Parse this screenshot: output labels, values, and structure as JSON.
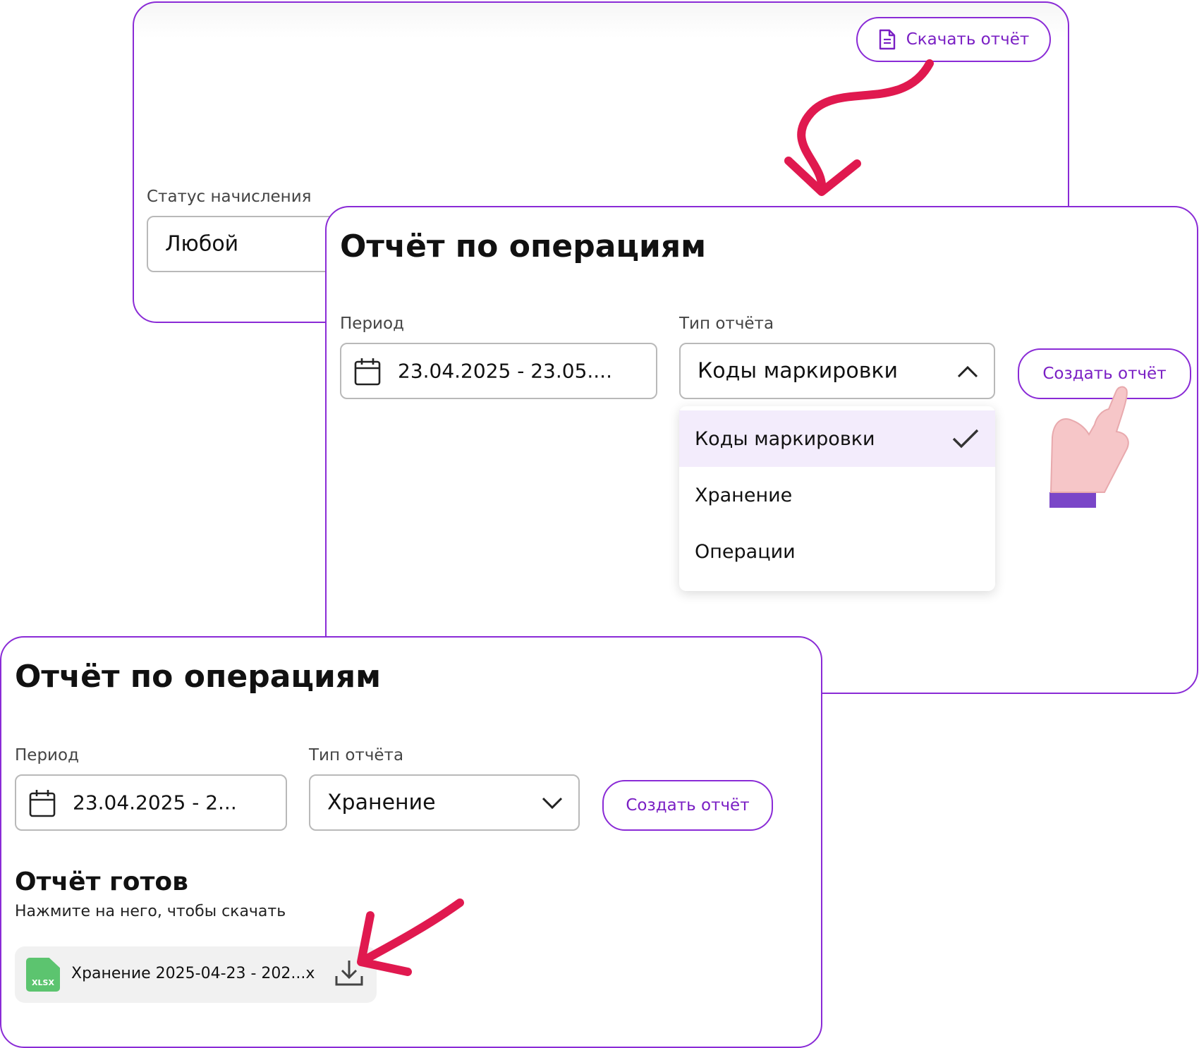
{
  "top_card": {
    "download_button_label": "Скачать отчёт",
    "status_label": "Статус начисления",
    "status_value": "Любой"
  },
  "middle_card": {
    "title": "Отчёт по операциям",
    "period_label": "Период",
    "period_value": "23.04.2025 - 23.05....",
    "type_label": "Тип отчёта",
    "type_value": "Коды маркировки",
    "create_button_label": "Создать отчёт",
    "dropdown_options": [
      "Коды маркировки",
      "Хранение",
      "Операции"
    ]
  },
  "bottom_card": {
    "title": "Отчёт по операциям",
    "period_label": "Период",
    "period_value": "23.04.2025 - 2...",
    "type_label": "Тип отчёта",
    "type_value": "Хранение",
    "create_button_label": "Создать отчёт",
    "ready_title": "Отчёт готов",
    "ready_subtitle": "Нажмите на него, чтобы скачать",
    "file_badge": "XLSX",
    "file_name": "Хранение 2025-04-23 - 202...x"
  },
  "colors": {
    "accent": "#8a2bd6",
    "annotation_arrow": "#e0194f",
    "file_icon": "#5cc46f",
    "dropdown_selected_bg": "#f3ecfc"
  },
  "icons": [
    "file-doc-icon",
    "calendar-icon",
    "chevron-up-icon",
    "chevron-down-icon",
    "check-icon",
    "xlsx-file-icon",
    "download-icon",
    "pointing-hand-icon",
    "curved-arrow-icon"
  ]
}
